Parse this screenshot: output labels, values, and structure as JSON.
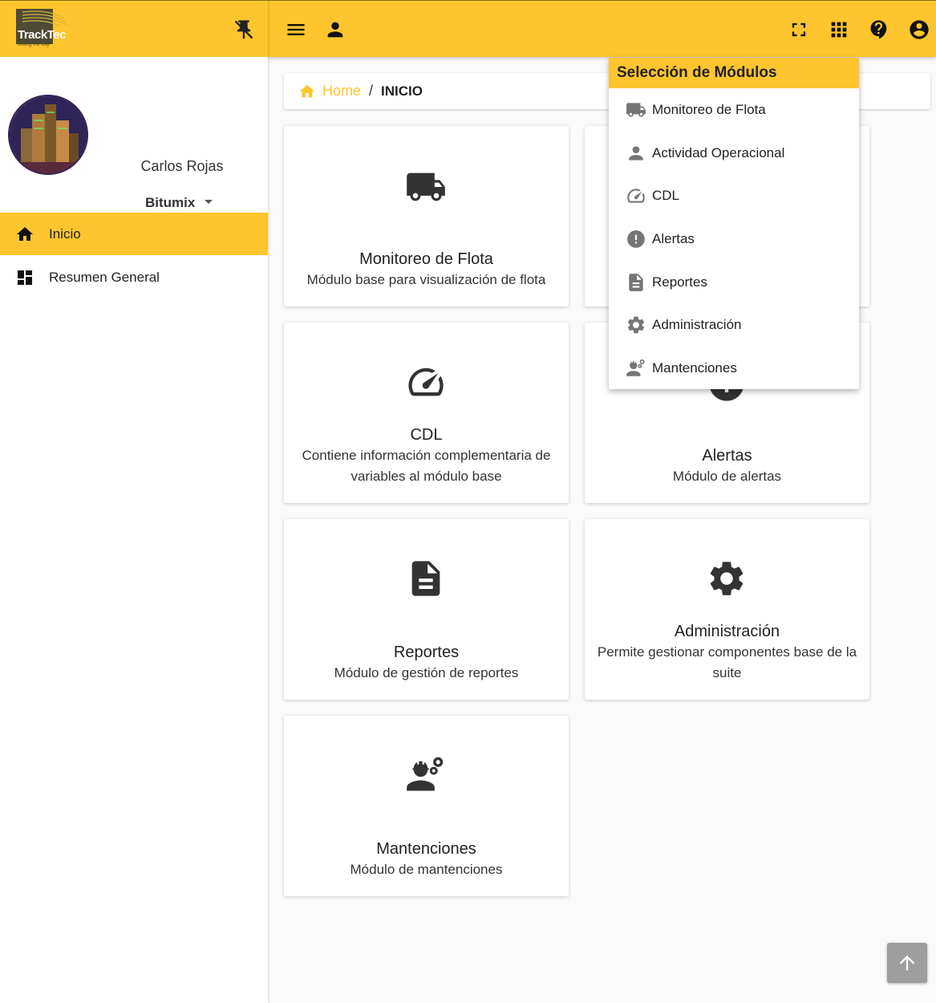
{
  "brand": {
    "logo_text_track": "Track",
    "logo_text_tec": "Tec",
    "tagline": "finding the way"
  },
  "user": {
    "name": "Carlos Rojas",
    "company": "Bitumix"
  },
  "sidebar": {
    "items": [
      {
        "label": "Inicio",
        "icon": "home-icon",
        "active": true
      },
      {
        "label": "Resumen General",
        "icon": "dashboard-icon",
        "active": false
      }
    ]
  },
  "breadcrumb": {
    "home": "Home",
    "separator": "/",
    "current": "INICIO"
  },
  "cards": [
    {
      "title": "Monitoreo de Flota",
      "description": "Módulo base para visualización de flota",
      "icon": "truck-icon"
    },
    {
      "title": "CDL",
      "description": "Contiene información complementaria de variables al módulo base",
      "icon": "speedometer-icon"
    },
    {
      "title": "Alertas",
      "description": "Módulo de alertas",
      "icon": "alert-icon"
    },
    {
      "title": "Reportes",
      "description": "Módulo de gestión de reportes",
      "icon": "document-icon"
    },
    {
      "title": "Administración",
      "description": "Permite gestionar componentes base de la suite",
      "icon": "gear-icon"
    },
    {
      "title": "Mantenciones",
      "description": "Módulo de mantenciones",
      "icon": "engineer-icon"
    }
  ],
  "modules_menu": {
    "title": "Selección de Módulos",
    "items": [
      {
        "label": "Monitoreo de Flota",
        "icon": "truck-icon"
      },
      {
        "label": "Actividad Operacional",
        "icon": "person-icon"
      },
      {
        "label": "CDL",
        "icon": "speedometer-icon"
      },
      {
        "label": "Alertas",
        "icon": "alert-icon"
      },
      {
        "label": "Reportes",
        "icon": "document-icon"
      },
      {
        "label": "Administración",
        "icon": "gear-icon"
      },
      {
        "label": "Mantenciones",
        "icon": "engineer-icon"
      }
    ]
  },
  "colors": {
    "accent": "#fec52e",
    "icon_dark": "#333333",
    "icon_menu": "#757575"
  }
}
